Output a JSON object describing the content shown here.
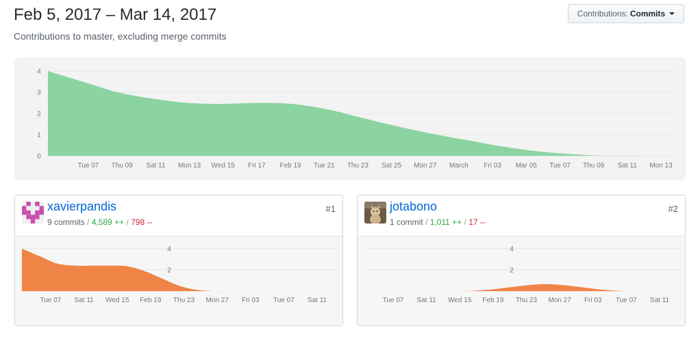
{
  "header": {
    "title": "Feb 5, 2017 – Mar 14, 2017",
    "subtitle": "Contributions to master, excluding merge commits",
    "dropdown_prefix": "Contributions:",
    "dropdown_value": "Commits"
  },
  "colors": {
    "main_fill": "#8cd3a2",
    "contributor_fill": "#f08446",
    "link": "#0366d6",
    "additions": "#28a745",
    "deletions": "#cb2431"
  },
  "contributors": [
    {
      "name": "xavierpandis",
      "commits": "9 commits",
      "additions": "4,589 ++",
      "deletions": "798 --",
      "rank": "#1",
      "avatar_icon": "identicon-icon"
    },
    {
      "name": "jotabono",
      "commits": "1 commit",
      "additions": "1,011 ++",
      "deletions": "17 --",
      "rank": "#2",
      "avatar_icon": "photo-avatar-icon"
    }
  ],
  "chart_data": [
    {
      "type": "area",
      "title": "",
      "x": [
        "Feb 5",
        "Feb 7",
        "Feb 9",
        "Feb 11",
        "Feb 13",
        "Feb 15",
        "Feb 17",
        "Feb 19",
        "Feb 21",
        "Feb 23",
        "Feb 25",
        "Feb 27",
        "Mar 1",
        "Mar 3",
        "Mar 5",
        "Mar 7",
        "Mar 9",
        "Mar 11",
        "Mar 13"
      ],
      "x_tick_labels": [
        "Tue 07",
        "Thu 09",
        "Sat 11",
        "Mon 13",
        "Wed 15",
        "Fri 17",
        "Feb 19",
        "Tue 21",
        "Thu 23",
        "Sat 25",
        "Mon 27",
        "March",
        "Fri 03",
        "Mar 05",
        "Tue 07",
        "Thu 09",
        "Sat 11",
        "Mon 13"
      ],
      "y_ticks": [
        0,
        1,
        2,
        3,
        4
      ],
      "ylim": [
        0,
        4
      ],
      "series": [
        {
          "values": [
            4.0,
            3.5,
            3.0,
            2.7,
            2.5,
            2.45,
            2.5,
            2.45,
            2.2,
            1.8,
            1.4,
            1.05,
            0.75,
            0.45,
            0.22,
            0.08,
            0.0,
            0.0,
            0.0
          ]
        }
      ],
      "grid": true
    },
    {
      "type": "area",
      "title": "",
      "x": [
        "Feb 5",
        "Feb 7",
        "Feb 9",
        "Feb 11",
        "Feb 13",
        "Feb 15",
        "Feb 17",
        "Feb 19",
        "Feb 21",
        "Feb 23",
        "Feb 25",
        "Feb 27",
        "Mar 1",
        "Mar 3",
        "Mar 5",
        "Mar 7",
        "Mar 9",
        "Mar 11",
        "Mar 13"
      ],
      "x_tick_labels": [
        "Tue 07",
        "Sat 11",
        "Wed 15",
        "Feb 19",
        "Thu 23",
        "Mon 27",
        "Fri 03",
        "Tue 07",
        "Sat 11"
      ],
      "y_ticks": [
        2,
        4
      ],
      "ylim": [
        0,
        4.5
      ],
      "series": [
        {
          "values": [
            4.0,
            3.3,
            2.6,
            2.4,
            2.4,
            2.4,
            2.35,
            1.9,
            1.2,
            0.5,
            0.12,
            0.0,
            0.0,
            0.0,
            0.0,
            0.0,
            0.0,
            0.0,
            0.0
          ]
        }
      ],
      "grid": true
    },
    {
      "type": "area",
      "title": "",
      "x": [
        "Feb 5",
        "Feb 7",
        "Feb 9",
        "Feb 11",
        "Feb 13",
        "Feb 15",
        "Feb 17",
        "Feb 19",
        "Feb 21",
        "Feb 23",
        "Feb 25",
        "Feb 27",
        "Mar 1",
        "Mar 3",
        "Mar 5",
        "Mar 7",
        "Mar 9",
        "Mar 11",
        "Mar 13"
      ],
      "x_tick_labels": [
        "Tue 07",
        "Sat 11",
        "Wed 15",
        "Feb 19",
        "Thu 23",
        "Mon 27",
        "Fri 03",
        "Tue 07",
        "Sat 11"
      ],
      "y_ticks": [
        2,
        4
      ],
      "ylim": [
        0,
        4.5
      ],
      "series": [
        {
          "values": [
            0,
            0,
            0,
            0,
            0,
            0,
            0.02,
            0.12,
            0.3,
            0.5,
            0.65,
            0.62,
            0.45,
            0.25,
            0.08,
            0.0,
            0.0,
            0.0,
            0.0
          ]
        }
      ],
      "grid": true
    }
  ]
}
